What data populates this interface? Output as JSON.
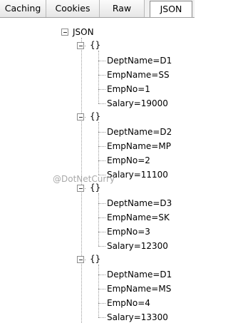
{
  "tabs": [
    {
      "label": "Caching",
      "active": false
    },
    {
      "label": "Cookies",
      "active": false
    },
    {
      "label": "Raw",
      "active": false
    },
    {
      "label": "JSON",
      "active": true
    }
  ],
  "tree": {
    "root_label": "JSON",
    "object_label": "{}",
    "records": [
      {
        "fields": [
          "DeptName=D1",
          "EmpName=SS",
          "EmpNo=1",
          "Salary=19000"
        ]
      },
      {
        "fields": [
          "DeptName=D2",
          "EmpName=MP",
          "EmpNo=2",
          "Salary=11100"
        ]
      },
      {
        "fields": [
          "DeptName=D3",
          "EmpName=SK",
          "EmpNo=3",
          "Salary=12300"
        ]
      },
      {
        "fields": [
          "DeptName=D1",
          "EmpName=MS",
          "EmpNo=4",
          "Salary=13300"
        ]
      }
    ]
  },
  "watermark": "@DotNetCurry"
}
